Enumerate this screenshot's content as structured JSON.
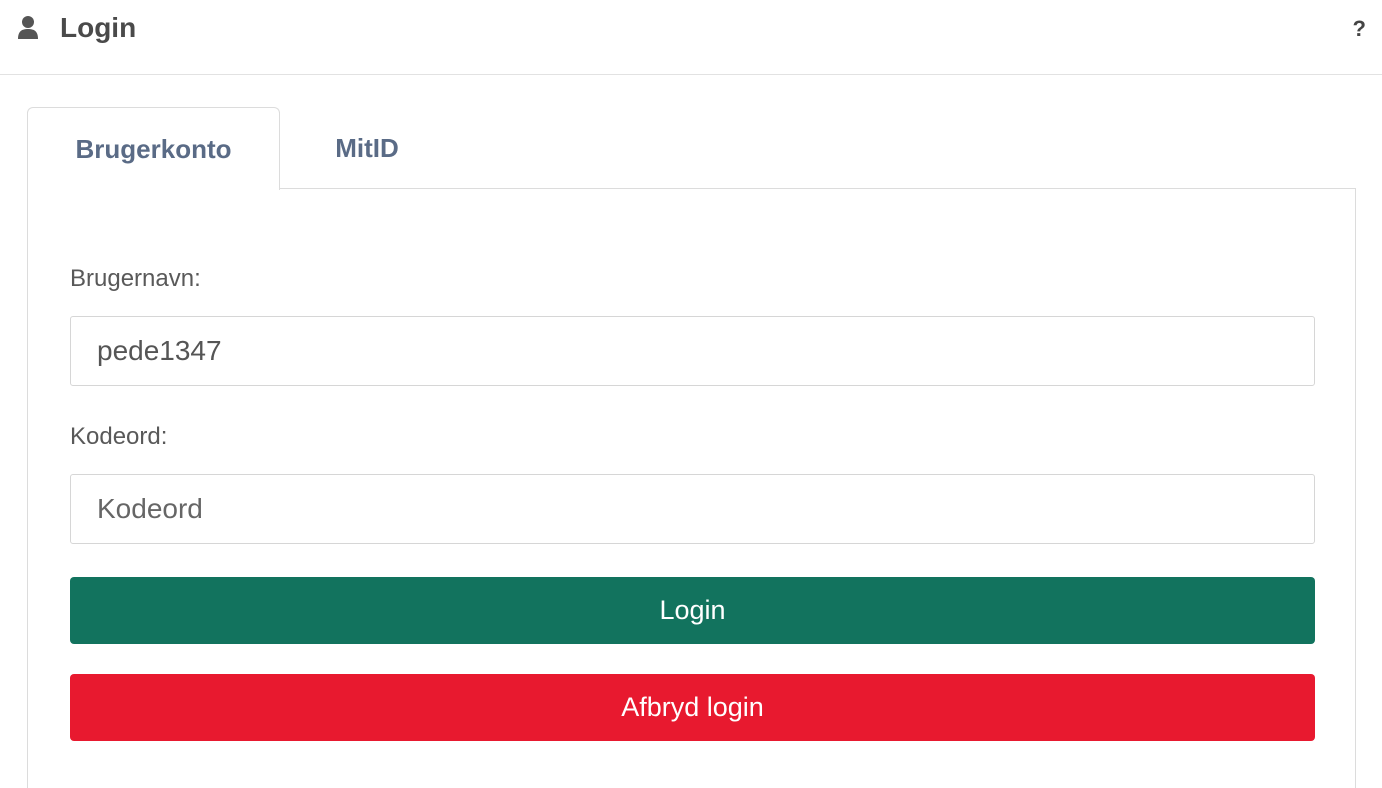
{
  "header": {
    "title": "Login",
    "help_label": "?",
    "icon": "user-icon"
  },
  "tabs": [
    {
      "label": "Brugerkonto",
      "active": true
    },
    {
      "label": "MitID",
      "active": false
    }
  ],
  "form": {
    "username_label": "Brugernavn:",
    "username_value": "pede1347",
    "password_label": "Kodeord:",
    "password_placeholder": "Kodeord",
    "login_button": "Login",
    "cancel_button": "Afbryd login"
  },
  "colors": {
    "login_button": "#12735e",
    "cancel_button": "#e8192f",
    "tab_text": "#5a6b86"
  }
}
